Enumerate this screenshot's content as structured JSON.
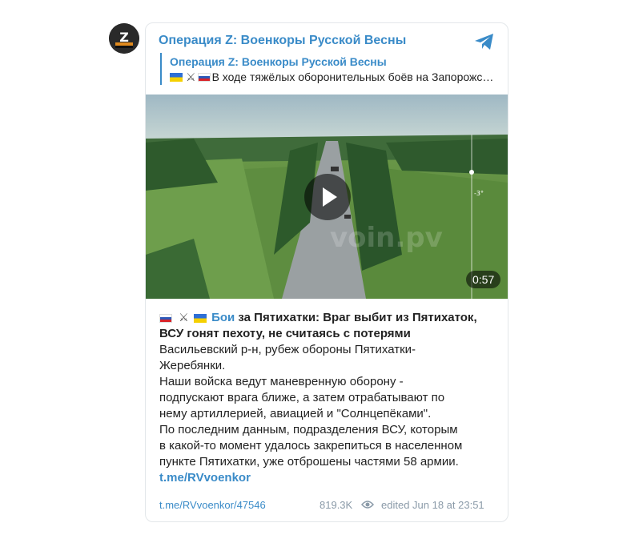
{
  "channel": {
    "name": "Операция Z: Военкоры Русской Весны",
    "avatar_letter": "Z",
    "accent_color": "#3a8bc8"
  },
  "quote": {
    "title": "Операция Z: Военкоры Русской Весны",
    "text": "В ходе тяжёлых оборонительных боёв на Запорожс…"
  },
  "video": {
    "duration": "0:57",
    "watermark": "voin.pv"
  },
  "post": {
    "highlight": "Бои",
    "headline_rest_line1": " за Пятихатки: Враг выбит из Пятихаток,",
    "headline_line2": "ВСУ гонят пехоту, не считаясь с потерями",
    "lines": [
      "Васильевский р-н, рубеж обороны Пятихатки-",
      "Жеребянки.",
      "Наши войска ведут маневренную оборону -",
      "подпускают врага ближе, а затем отрабатывают по",
      "нему артиллерией, авиацией и \"Солнцепёками\".",
      "По последним данным, подразделения ВСУ, которым",
      "в какой-то момент удалось закрепиться в населенном",
      "пункте Пятихатки, уже отброшены частями 58 армии."
    ],
    "channel_link": "t.me/RVvoenkor"
  },
  "footer": {
    "post_link": "t.me/RVvoenkor/47546",
    "views": "819.3K",
    "edited": "edited  Jun 18 at 23:51"
  }
}
